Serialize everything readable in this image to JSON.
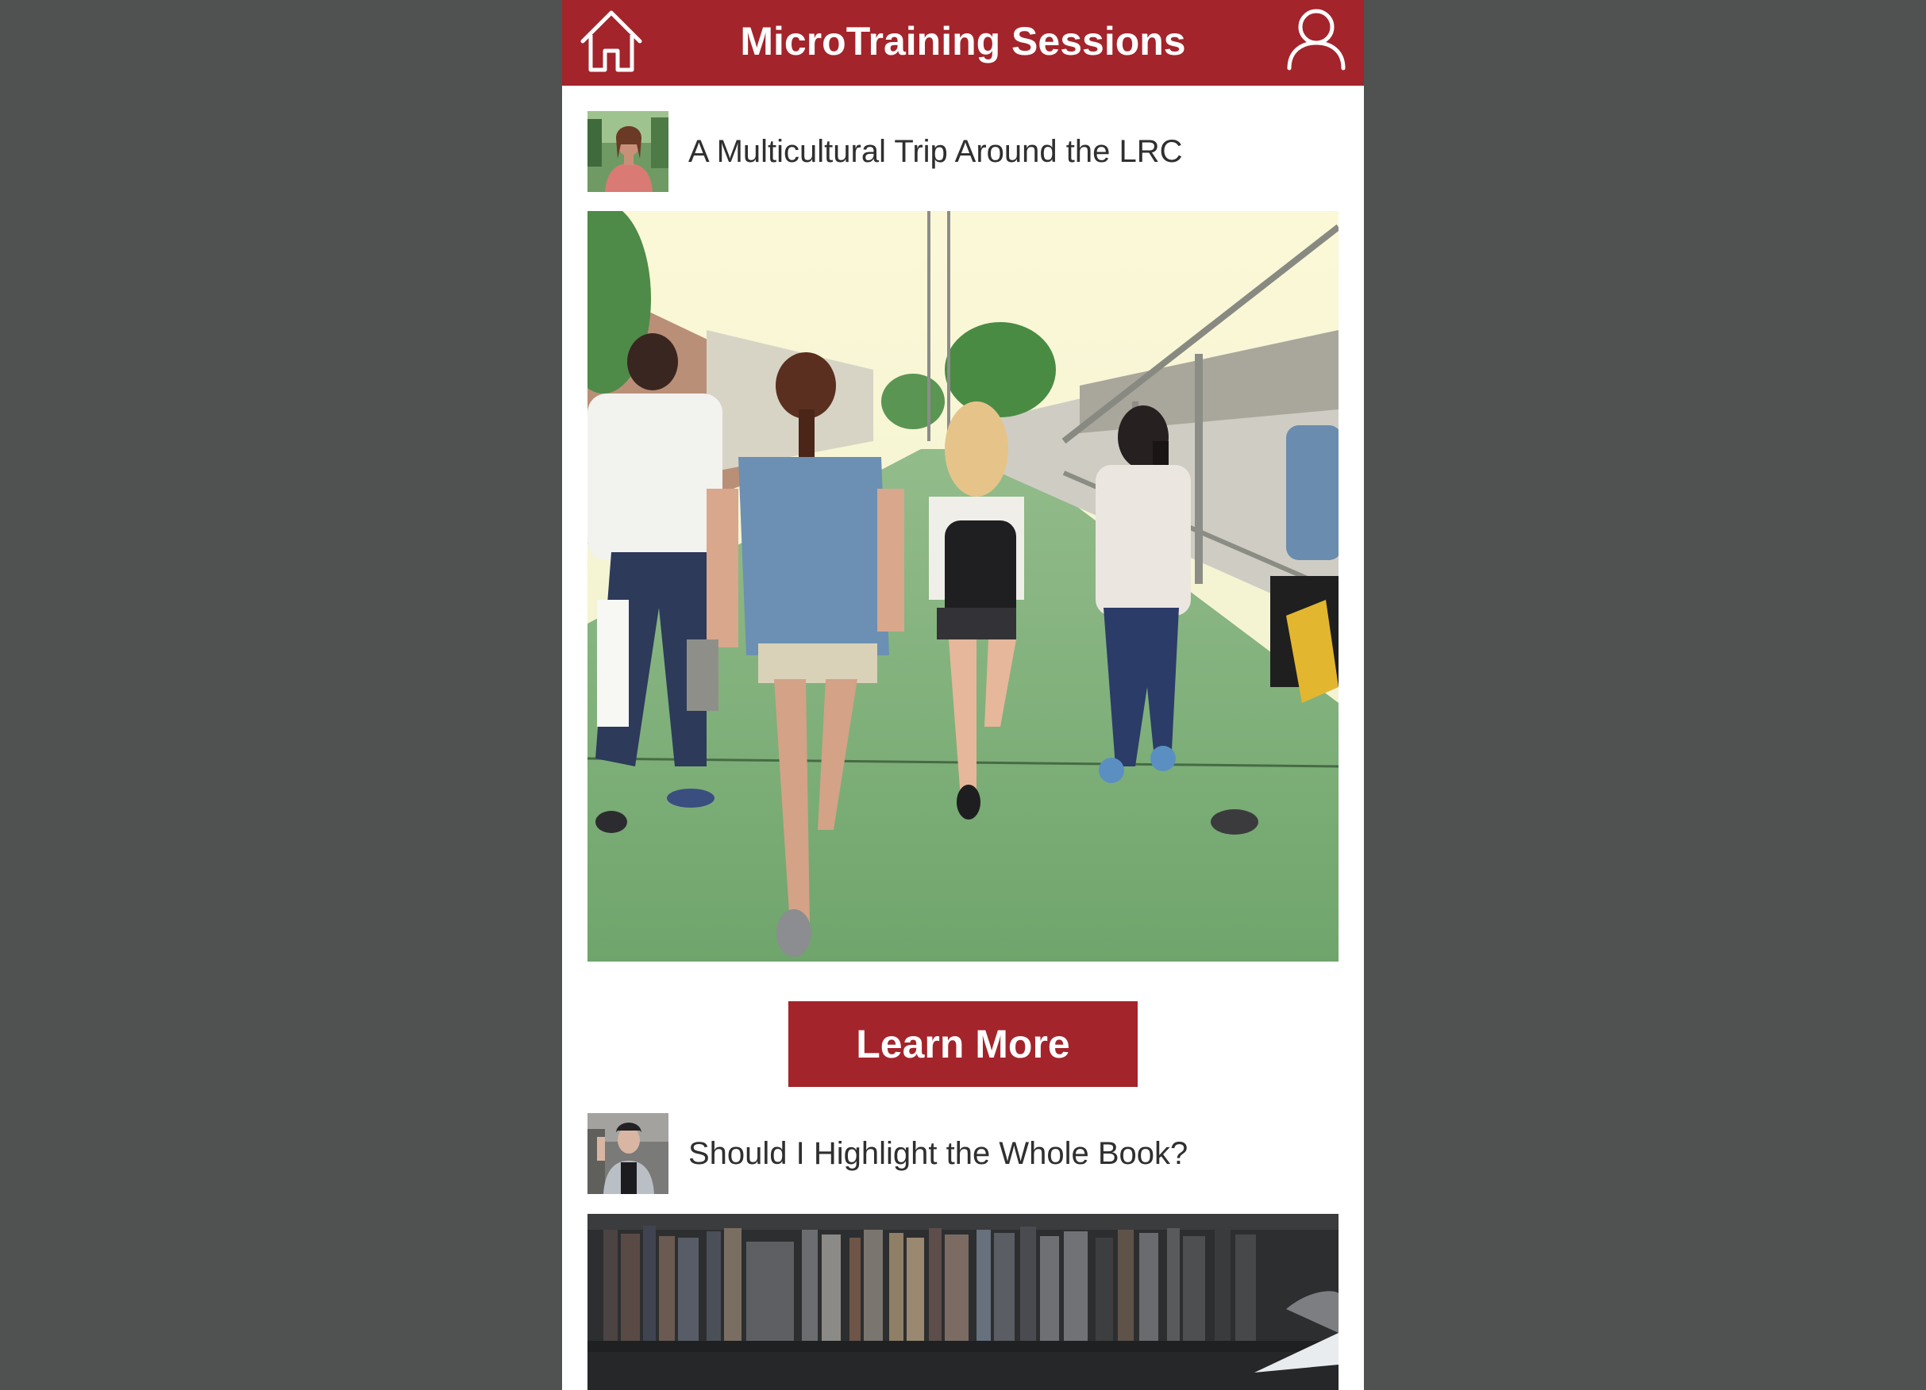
{
  "header": {
    "title": "MicroTraining Sessions",
    "home_icon": "home-icon",
    "profile_icon": "user-profile-icon"
  },
  "sessions": [
    {
      "title": "A Multicultural Trip Around the LRC",
      "avatar_icon": "presenter-avatar",
      "image": "students-walking-photo",
      "cta_label": "Learn More"
    },
    {
      "title": "Should I Highlight the Whole Book?",
      "avatar_icon": "presenter-avatar",
      "image": "bookshelf-photo"
    }
  ],
  "colors": {
    "brand": "#a3242b",
    "page_background": "#505251",
    "card_background": "#ffffff",
    "text": "#2f2f2f"
  }
}
